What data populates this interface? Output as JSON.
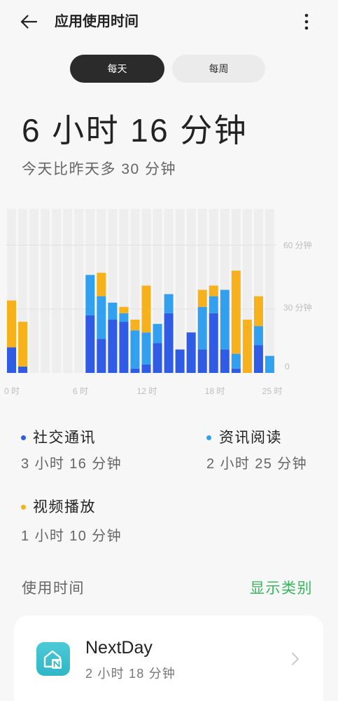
{
  "header": {
    "title": "应用使用时间",
    "back_icon": "back-arrow-icon",
    "menu_icon": "more-vertical-icon"
  },
  "tabs": [
    {
      "label": "每天",
      "selected": true
    },
    {
      "label": "每周",
      "selected": false
    }
  ],
  "summary": {
    "total": "6 小时 16 分钟",
    "compare": "今天比昨天多 30 分钟"
  },
  "chart_data": {
    "type": "bar",
    "stacked": true,
    "x": [
      0,
      1,
      2,
      3,
      4,
      5,
      6,
      7,
      8,
      9,
      10,
      11,
      12,
      13,
      14,
      15,
      16,
      17,
      18,
      19,
      20,
      21,
      22,
      23
    ],
    "x_tick_labels": [
      "0 时",
      "6 时",
      "12 时",
      "18 时",
      "25 时"
    ],
    "y_tick_labels": [
      "60 分钟",
      "30 分钟",
      "0"
    ],
    "y_gridlines": [
      30,
      60
    ],
    "ylim": [
      0,
      77
    ],
    "grid": true,
    "series": [
      {
        "name": "社交通讯",
        "color": "#2f5be5",
        "values": [
          12,
          3,
          0,
          0,
          0,
          0,
          0,
          27,
          16,
          25,
          24,
          2,
          4,
          14,
          28,
          11,
          19,
          11,
          28,
          11,
          2,
          0,
          13,
          0
        ]
      },
      {
        "name": "资讯阅读",
        "color": "#33a0ef",
        "values": [
          0,
          0,
          0,
          0,
          0,
          0,
          0,
          19,
          20,
          8,
          4,
          18,
          15,
          9,
          9,
          0,
          0,
          20,
          8,
          28,
          7,
          0,
          9,
          8
        ]
      },
      {
        "name": "视频播放",
        "color": "#f6b11c",
        "values": [
          22,
          21,
          0,
          0,
          0,
          0,
          0,
          0,
          11,
          0,
          3,
          5,
          22,
          0,
          0,
          0,
          0,
          8,
          5,
          0,
          39,
          25,
          14,
          0
        ]
      }
    ]
  },
  "legend": [
    {
      "name": "社交通讯",
      "duration": "3 小时 16 分钟",
      "color": "#2f5be5"
    },
    {
      "name": "资讯阅读",
      "duration": "2 小时 25 分钟",
      "color": "#33a0ef"
    },
    {
      "name": "视频播放",
      "duration": "1 小时 10 分钟",
      "color": "#f6b11c"
    }
  ],
  "usage": {
    "title": "使用时间",
    "toggle_label": "显示类别",
    "toggle_color": "#3bb45f"
  },
  "apps": [
    {
      "name": "NextDay",
      "duration": "2 小时 18 分钟",
      "icon": "nextday-app-icon",
      "icon_color": "#3cc1cf"
    }
  ],
  "icons": {
    "chevron": "chevron-right-icon"
  }
}
